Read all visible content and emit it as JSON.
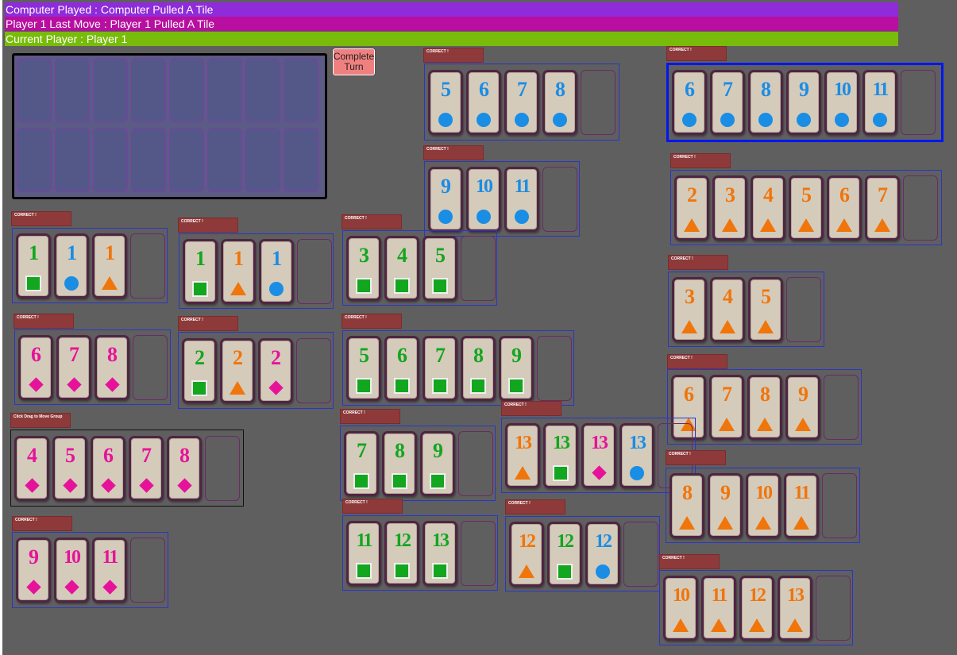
{
  "status": {
    "computer_played": "Computer Played : Computer Pulled A Tile",
    "last_move": "Player 1 Last Move : Player 1 Pulled A Tile",
    "current_player": "Current Player : Player 1"
  },
  "complete_turn_label": "Complete Turn",
  "hand": {
    "empty_slots": 16
  },
  "colors": {
    "green": "#13a61f",
    "blue": "#1a8de4",
    "orange": "#f0750a",
    "pink": "#e6139a"
  },
  "groups": [
    {
      "label": "CORRECT !",
      "tiles": [
        {
          "n": "5",
          "c": "blue"
        },
        {
          "n": "6",
          "c": "blue"
        },
        {
          "n": "7",
          "c": "blue"
        },
        {
          "n": "8",
          "c": "blue"
        }
      ]
    },
    {
      "label": "CORRECT !",
      "selected": true,
      "tiles": [
        {
          "n": "6",
          "c": "blue"
        },
        {
          "n": "7",
          "c": "blue"
        },
        {
          "n": "8",
          "c": "blue"
        },
        {
          "n": "9",
          "c": "blue"
        },
        {
          "n": "10",
          "c": "blue"
        },
        {
          "n": "11",
          "c": "blue"
        }
      ]
    },
    {
      "label": "CORRECT !",
      "tiles": [
        {
          "n": "9",
          "c": "blue"
        },
        {
          "n": "10",
          "c": "blue"
        },
        {
          "n": "11",
          "c": "blue"
        }
      ]
    },
    {
      "label": "CORRECT !",
      "tiles": [
        {
          "n": "2",
          "c": "orange"
        },
        {
          "n": "3",
          "c": "orange"
        },
        {
          "n": "4",
          "c": "orange"
        },
        {
          "n": "5",
          "c": "orange"
        },
        {
          "n": "6",
          "c": "orange"
        },
        {
          "n": "7",
          "c": "orange"
        }
      ]
    },
    {
      "label": "CORRECT !",
      "tiles": [
        {
          "n": "1",
          "c": "green"
        },
        {
          "n": "1",
          "c": "blue"
        },
        {
          "n": "1",
          "c": "orange"
        }
      ]
    },
    {
      "label": "CORRECT !",
      "tiles": [
        {
          "n": "1",
          "c": "green"
        },
        {
          "n": "1",
          "c": "orange"
        },
        {
          "n": "1",
          "c": "blue"
        }
      ]
    },
    {
      "label": "CORRECT !",
      "tiles": [
        {
          "n": "3",
          "c": "green"
        },
        {
          "n": "4",
          "c": "green"
        },
        {
          "n": "5",
          "c": "green"
        }
      ]
    },
    {
      "label": "CORRECT !",
      "tiles": [
        {
          "n": "3",
          "c": "orange"
        },
        {
          "n": "4",
          "c": "orange"
        },
        {
          "n": "5",
          "c": "orange"
        }
      ]
    },
    {
      "label": "CORRECT !",
      "tiles": [
        {
          "n": "6",
          "c": "pink"
        },
        {
          "n": "7",
          "c": "pink"
        },
        {
          "n": "8",
          "c": "pink"
        }
      ]
    },
    {
      "label": "CORRECT !",
      "tiles": [
        {
          "n": "2",
          "c": "green"
        },
        {
          "n": "2",
          "c": "orange"
        },
        {
          "n": "2",
          "c": "pink"
        }
      ]
    },
    {
      "label": "CORRECT !",
      "tiles": [
        {
          "n": "5",
          "c": "green"
        },
        {
          "n": "6",
          "c": "green"
        },
        {
          "n": "7",
          "c": "green"
        },
        {
          "n": "8",
          "c": "green"
        },
        {
          "n": "9",
          "c": "green"
        }
      ]
    },
    {
      "label": "CORRECT !",
      "tiles": [
        {
          "n": "6",
          "c": "orange"
        },
        {
          "n": "7",
          "c": "orange"
        },
        {
          "n": "8",
          "c": "orange"
        },
        {
          "n": "9",
          "c": "orange"
        }
      ]
    },
    {
      "label": "CORRECT !",
      "tiles": [
        {
          "n": "13",
          "c": "orange"
        },
        {
          "n": "13",
          "c": "green"
        },
        {
          "n": "13",
          "c": "pink"
        },
        {
          "n": "13",
          "c": "blue"
        }
      ]
    },
    {
      "label": "Click Drag to Move Group",
      "dark": true,
      "tiles": [
        {
          "n": "4",
          "c": "pink"
        },
        {
          "n": "5",
          "c": "pink"
        },
        {
          "n": "6",
          "c": "pink"
        },
        {
          "n": "7",
          "c": "pink"
        },
        {
          "n": "8",
          "c": "pink"
        }
      ]
    },
    {
      "label": "CORRECT !",
      "tiles": [
        {
          "n": "7",
          "c": "green"
        },
        {
          "n": "8",
          "c": "green"
        },
        {
          "n": "9",
          "c": "green"
        }
      ]
    },
    {
      "label": "CORRECT !",
      "tiles": [
        {
          "n": "8",
          "c": "orange"
        },
        {
          "n": "9",
          "c": "orange"
        },
        {
          "n": "10",
          "c": "orange"
        },
        {
          "n": "11",
          "c": "orange"
        }
      ]
    },
    {
      "label": "CORRECT !",
      "tiles": [
        {
          "n": "9",
          "c": "pink"
        },
        {
          "n": "10",
          "c": "pink"
        },
        {
          "n": "11",
          "c": "pink"
        }
      ]
    },
    {
      "label": "CORRECT !",
      "tiles": [
        {
          "n": "11",
          "c": "green"
        },
        {
          "n": "12",
          "c": "green"
        },
        {
          "n": "13",
          "c": "green"
        }
      ]
    },
    {
      "label": "CORRECT !",
      "tiles": [
        {
          "n": "12",
          "c": "orange"
        },
        {
          "n": "12",
          "c": "green"
        },
        {
          "n": "12",
          "c": "blue"
        }
      ]
    },
    {
      "label": "CORRECT !",
      "tiles": [
        {
          "n": "10",
          "c": "orange"
        },
        {
          "n": "11",
          "c": "orange"
        },
        {
          "n": "12",
          "c": "orange"
        },
        {
          "n": "13",
          "c": "orange"
        }
      ]
    }
  ]
}
